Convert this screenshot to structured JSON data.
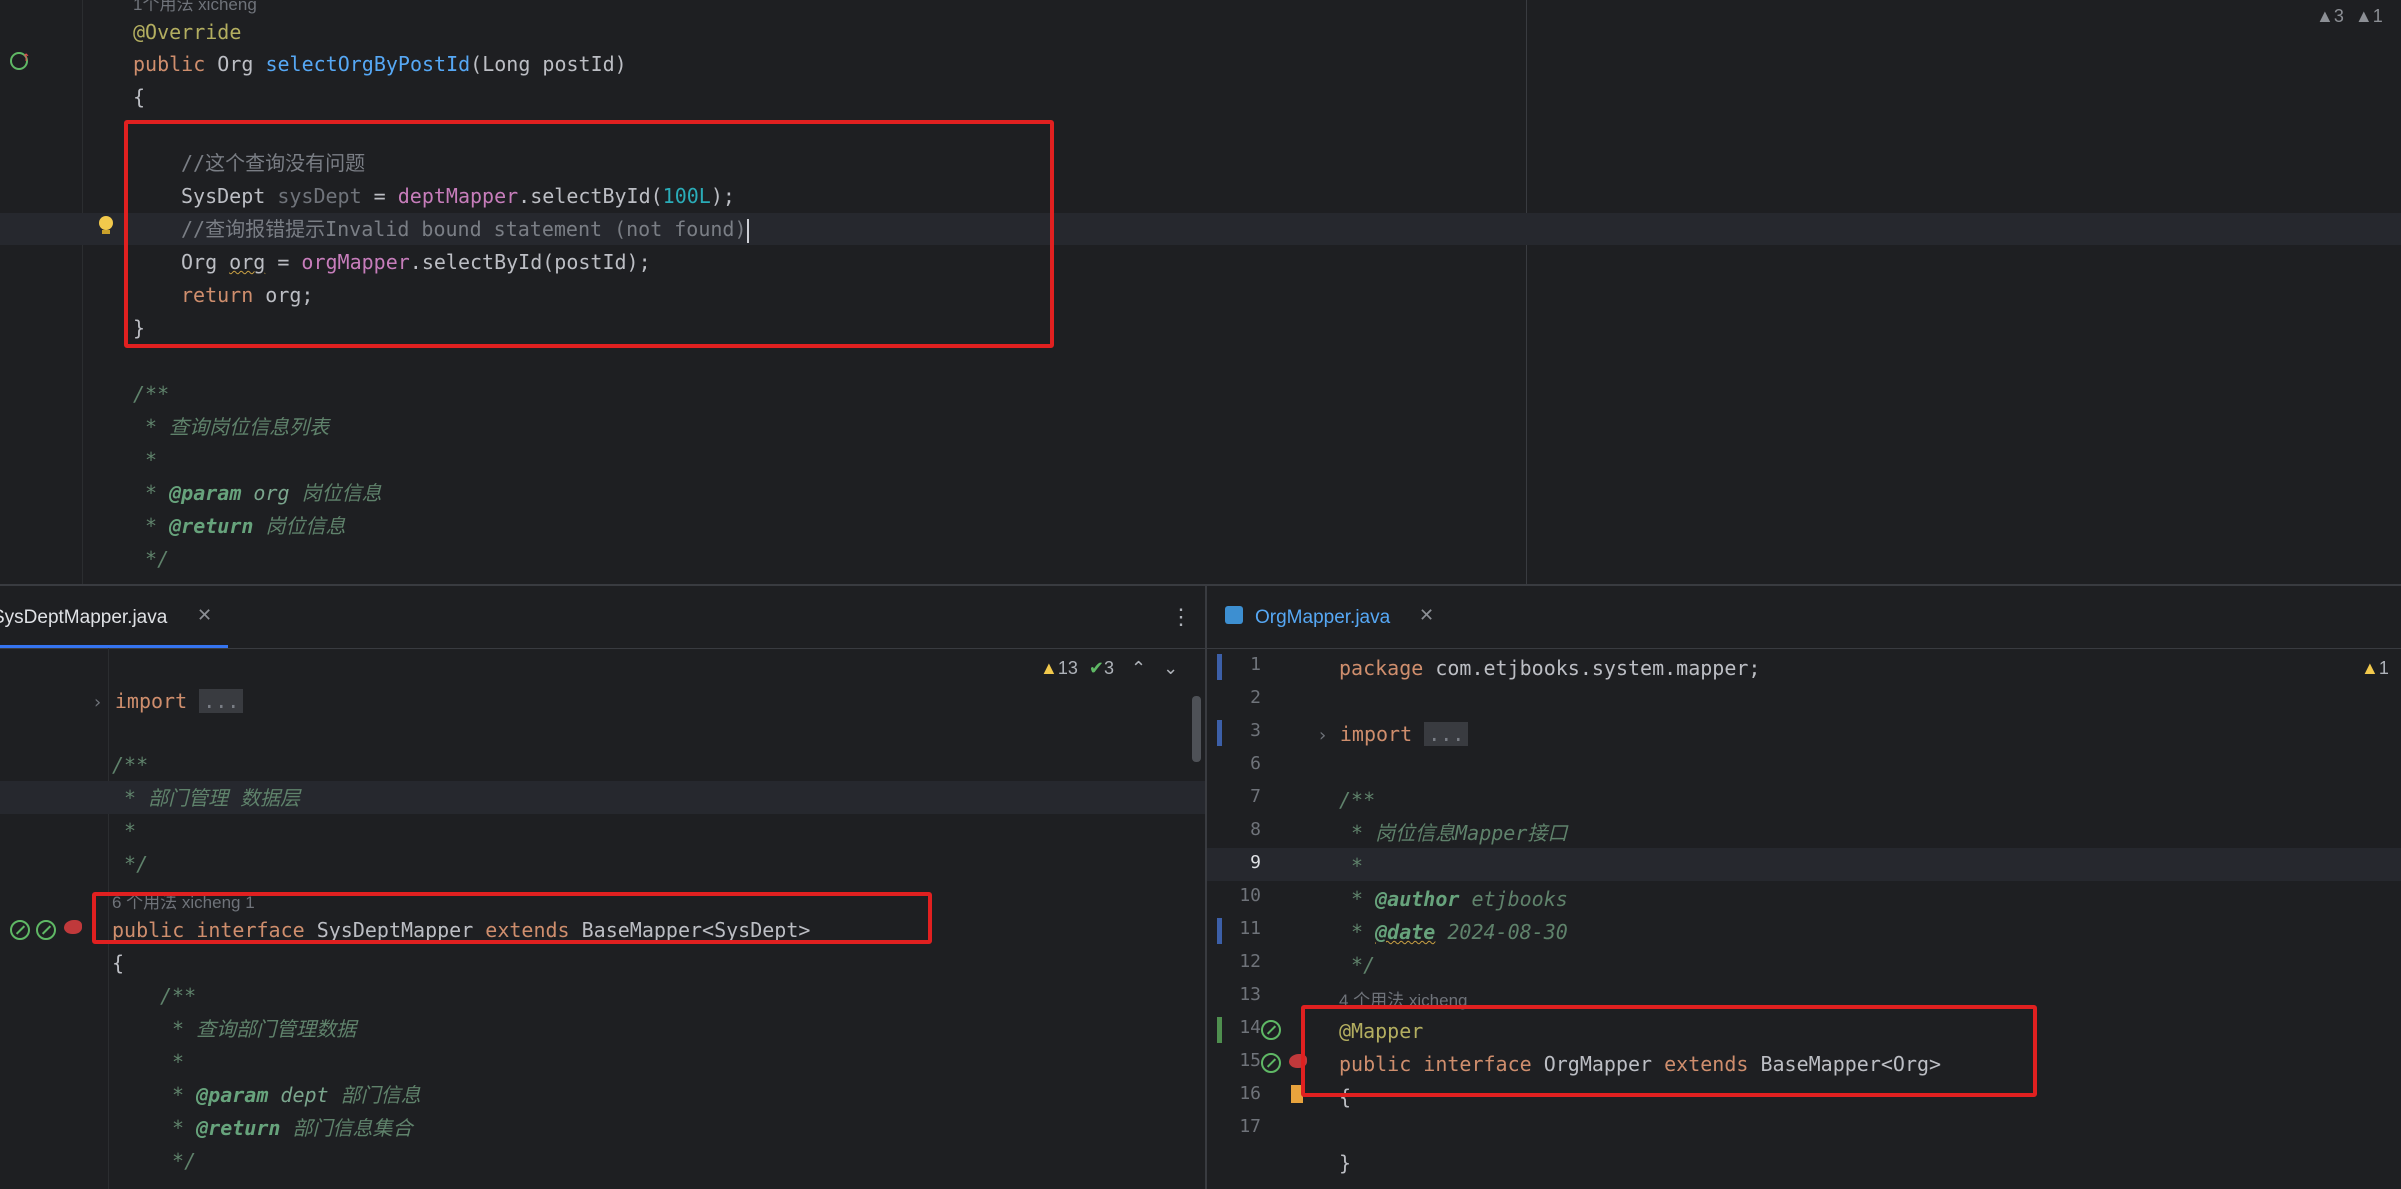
{
  "top_editor": {
    "hint_line": "1个用法   xicheng",
    "warnings": {
      "warn_count": "3",
      "other_count": "1"
    },
    "line1": "@Override",
    "line2": {
      "kw": "public",
      "type": " Org ",
      "fn": "selectOrgByPostId",
      "rest": "(Long postId)"
    },
    "brace_open": "{",
    "comment1": "//这个查询没有问题",
    "line_sysdept": {
      "type": "SysDept ",
      "var": "sysDept",
      "eq": " = ",
      "field": "deptMapper",
      "call": ".selectById(",
      "num": "100L",
      "end": ");"
    },
    "comment2": "//查询报错提示Invalid bound statement (not found)",
    "line_org": {
      "type": "Org ",
      "var": "org",
      "eq": " = ",
      "field": "orgMapper",
      "call": ".selectById(postId);"
    },
    "line_return": {
      "kw": "return",
      "rest": " org;"
    },
    "brace_close": "}",
    "javadoc": {
      "open": "/**",
      "desc": " * 查询岗位信息列表",
      "star": " *",
      "param_tag": "@param",
      "param_name": " org ",
      "param_desc": "岗位信息",
      "return_tag": "@return",
      "return_desc": " 岗位信息",
      "close": " */"
    }
  },
  "left_pane": {
    "tab": {
      "label": "SysDeptMapper.java"
    },
    "inspection": {
      "warnings": "13",
      "checks": "3"
    },
    "import_kw": "import",
    "import_fold": "...",
    "doc": {
      "open": "/**",
      "desc": " * 部门管理 数据层",
      "star": " *",
      "close": " */"
    },
    "hint_line": "6 个用法   xicheng 1",
    "decl": {
      "kw1": "public",
      "kw2": "interface",
      "name": " SysDeptMapper ",
      "kw3": "extends",
      "rest": " BaseMapper<SysDept>"
    },
    "brace": "{",
    "inner_doc": {
      "open": "/**",
      "desc": " * 查询部门管理数据",
      "star": " *",
      "param_tag": "@param",
      "param_name": " dept ",
      "param_desc": "部门信息",
      "return_tag": "@return",
      "return_desc": " 部门信息集合",
      "close": " */"
    }
  },
  "right_pane": {
    "tab": {
      "label": "OrgMapper.java"
    },
    "warnings": "1",
    "line_numbers": [
      "1",
      "2",
      "3",
      "6",
      "7",
      "8",
      "9",
      "10",
      "11",
      "12",
      "13",
      "14",
      "15",
      "16",
      "17"
    ],
    "package": {
      "kw": "package",
      "rest": " com.etjbooks.system.mapper;"
    },
    "import_kw": "import",
    "import_fold": "...",
    "doc": {
      "open": "/**",
      "desc": " * 岗位信息Mapper接口",
      "star": " *",
      "author_tag": "@author",
      "author_val": " etjbooks",
      "date_tag": "@date",
      "date_val": " 2024-08-30",
      "close": " */"
    },
    "hint_line": "4 个用法   xicheng",
    "annotation": "@Mapper",
    "decl": {
      "kw1": "public",
      "kw2": "interface",
      "name": " OrgMapper ",
      "kw3": "extends",
      "rest": " BaseMapper<Org>"
    },
    "brace_open": "{",
    "brace_close": "}"
  },
  "colors": {
    "red_box": "#e02020",
    "keyword": "#cf8e6d",
    "method": "#56a8f5",
    "field": "#c77dbb",
    "number": "#2aacb8",
    "annotation": "#b3ae60"
  }
}
